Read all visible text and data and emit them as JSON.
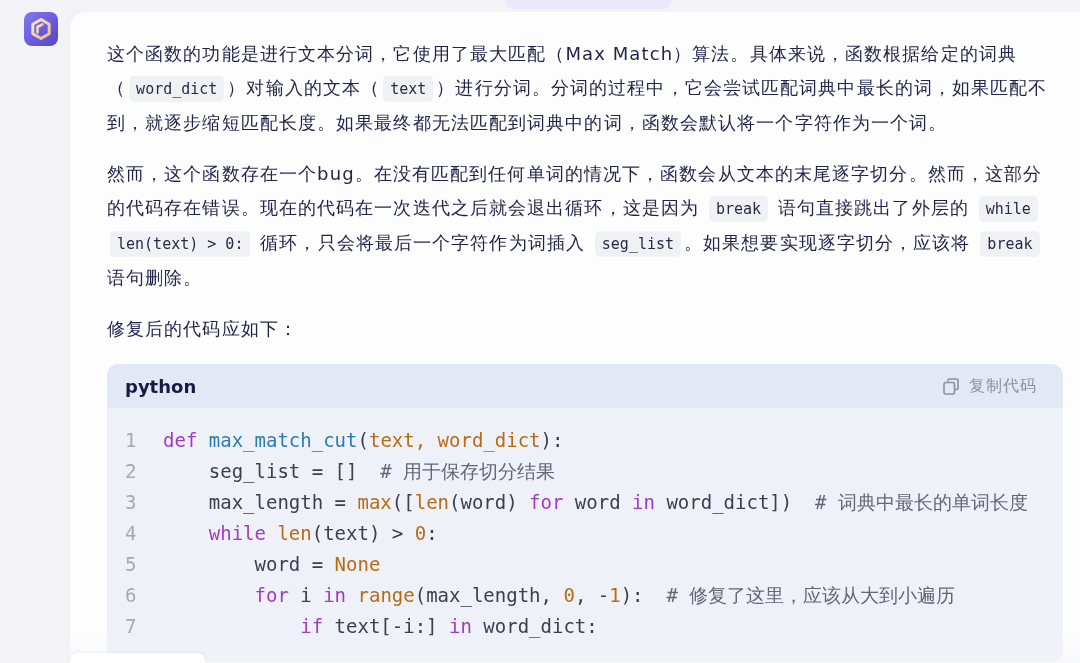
{
  "message": {
    "paragraphs": [
      {
        "segments": [
          {
            "kind": "text",
            "text": "这个函数的功能是进行文本分词，它使用了最大匹配（Max Match）算法。具体来说，函数根据给定的词典（"
          },
          {
            "kind": "code",
            "text": "word_dict"
          },
          {
            "kind": "text",
            "text": "）对输入的文本（"
          },
          {
            "kind": "code",
            "text": "text"
          },
          {
            "kind": "text",
            "text": "）进行分词。分词的过程中，它会尝试匹配词典中最长的词，如果匹配不到，就逐步缩短匹配长度。如果最终都无法匹配到词典中的词，函数会默认将一个字符作为一个词。"
          }
        ]
      },
      {
        "segments": [
          {
            "kind": "text",
            "text": "然而，这个函数存在一个bug。在没有匹配到任何单词的情况下，函数会从文本的末尾逐字切分。然而，这部分的代码存在错误。现在的代码在一次迭代之后就会退出循环，这是因为 "
          },
          {
            "kind": "code",
            "text": "break"
          },
          {
            "kind": "text",
            "text": " 语句直接跳出了外层的 "
          },
          {
            "kind": "code",
            "text": "while len(text) > 0:"
          },
          {
            "kind": "text",
            "text": " 循环，只会将最后一个字符作为词插入 "
          },
          {
            "kind": "code",
            "text": "seg_list"
          },
          {
            "kind": "text",
            "text": "。如果想要实现逐字切分，应该将 "
          },
          {
            "kind": "code",
            "text": "break"
          },
          {
            "kind": "text",
            "text": " 语句删除。"
          }
        ]
      },
      {
        "segments": [
          {
            "kind": "text",
            "text": "修复后的代码应如下："
          }
        ]
      }
    ],
    "code_block": {
      "language": "python",
      "copy_label": "复制代码",
      "lines": [
        {
          "number": "1",
          "tokens": [
            {
              "kind": "keyword",
              "text": "def "
            },
            {
              "kind": "function",
              "text": "max_match_cut"
            },
            {
              "kind": "plain",
              "text": "("
            },
            {
              "kind": "param",
              "text": "text, word_dict"
            },
            {
              "kind": "plain",
              "text": "):"
            }
          ]
        },
        {
          "number": "2",
          "tokens": [
            {
              "kind": "plain",
              "text": "    seg_list = []  "
            },
            {
              "kind": "comment",
              "text": "# 用于保存切分结果"
            }
          ]
        },
        {
          "number": "3",
          "tokens": [
            {
              "kind": "plain",
              "text": "    max_length = "
            },
            {
              "kind": "builtin",
              "text": "max"
            },
            {
              "kind": "plain",
              "text": "(["
            },
            {
              "kind": "builtin",
              "text": "len"
            },
            {
              "kind": "plain",
              "text": "(word) "
            },
            {
              "kind": "keyword",
              "text": "for"
            },
            {
              "kind": "plain",
              "text": " word "
            },
            {
              "kind": "keyword",
              "text": "in"
            },
            {
              "kind": "plain",
              "text": " word_dict])  "
            },
            {
              "kind": "comment",
              "text": "# 词典中最长的单词长度"
            }
          ]
        },
        {
          "number": "4",
          "tokens": [
            {
              "kind": "keyword",
              "text": "    while"
            },
            {
              "kind": "builtin",
              "text": " len"
            },
            {
              "kind": "plain",
              "text": "(text) > "
            },
            {
              "kind": "number",
              "text": "0"
            },
            {
              "kind": "plain",
              "text": ":"
            }
          ]
        },
        {
          "number": "5",
          "tokens": [
            {
              "kind": "plain",
              "text": "        word = "
            },
            {
              "kind": "constant",
              "text": "None"
            }
          ]
        },
        {
          "number": "6",
          "tokens": [
            {
              "kind": "keyword",
              "text": "        for"
            },
            {
              "kind": "plain",
              "text": " i "
            },
            {
              "kind": "keyword",
              "text": "in"
            },
            {
              "kind": "builtin",
              "text": " range"
            },
            {
              "kind": "plain",
              "text": "(max_length, "
            },
            {
              "kind": "number",
              "text": "0"
            },
            {
              "kind": "plain",
              "text": ", -"
            },
            {
              "kind": "number",
              "text": "1"
            },
            {
              "kind": "plain",
              "text": "):  "
            },
            {
              "kind": "comment",
              "text": "# 修复了这里，应该从大到小遍历"
            }
          ]
        },
        {
          "number": "7",
          "tokens": [
            {
              "kind": "keyword",
              "text": "            if"
            },
            {
              "kind": "plain",
              "text": " text[-i:] "
            },
            {
              "kind": "keyword",
              "text": "in"
            },
            {
              "kind": "plain",
              "text": " word_dict:"
            }
          ]
        }
      ]
    }
  }
}
